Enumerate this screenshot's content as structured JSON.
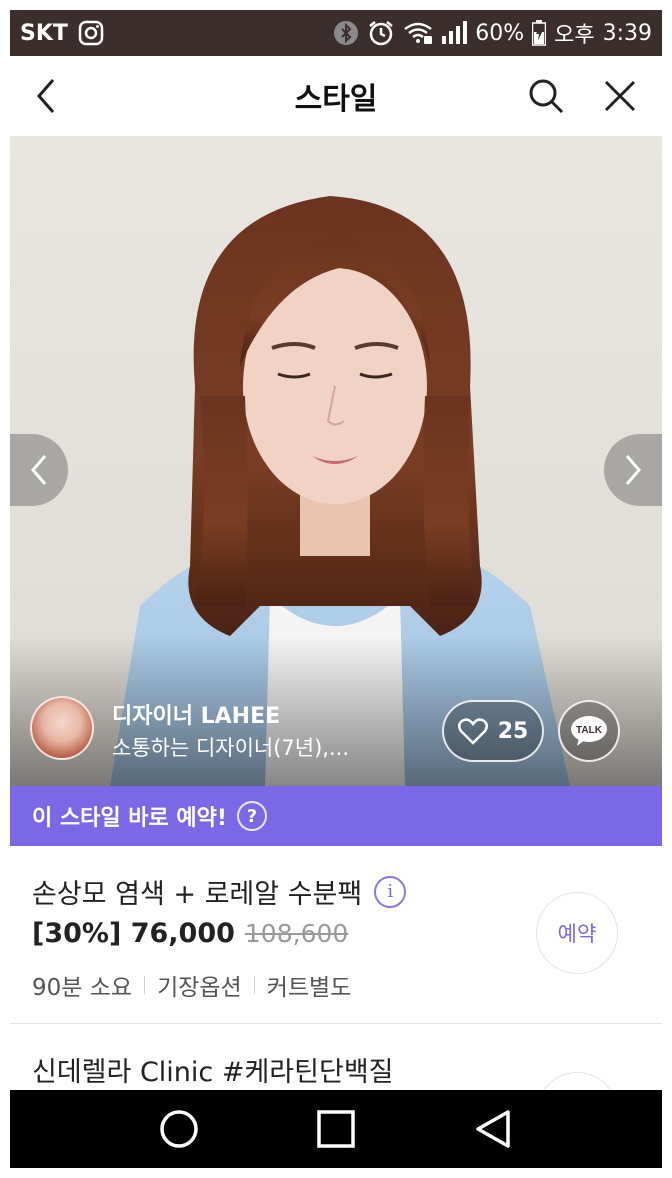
{
  "status_bar": {
    "carrier": "SKT",
    "battery": "60%",
    "ampm": "오후",
    "time": "3:39",
    "icons": [
      "instagram-icon",
      "bluetooth-icon",
      "alarm-icon",
      "wifi-icon",
      "signal-icon",
      "battery-icon"
    ]
  },
  "header": {
    "title": "스타일",
    "back_icon": "chevron-left-icon",
    "search_icon": "search-icon",
    "close_icon": "close-icon"
  },
  "hero": {
    "designer_name": "디자이너 LAHEE",
    "designer_desc": "소통하는 디자이너(7년),...",
    "likes": "25",
    "talk_label": "TALK"
  },
  "booking": {
    "label": "이 스타일 바로 예약!",
    "help": "?"
  },
  "products": [
    {
      "name": "손상모 염색 + 로레알 수분팩",
      "discount_price": "[30%] 76,000",
      "original_price": "108,600",
      "meta": [
        "90분 소요",
        "기장옵션",
        "커트별도"
      ],
      "reserve_label": "예약"
    },
    {
      "name": "신데렐라 Clinic #케라틴단백질"
    }
  ],
  "colors": {
    "accent": "#7b68e6",
    "status_bar": "#3b2e2c",
    "nav_bar": "#000000"
  }
}
